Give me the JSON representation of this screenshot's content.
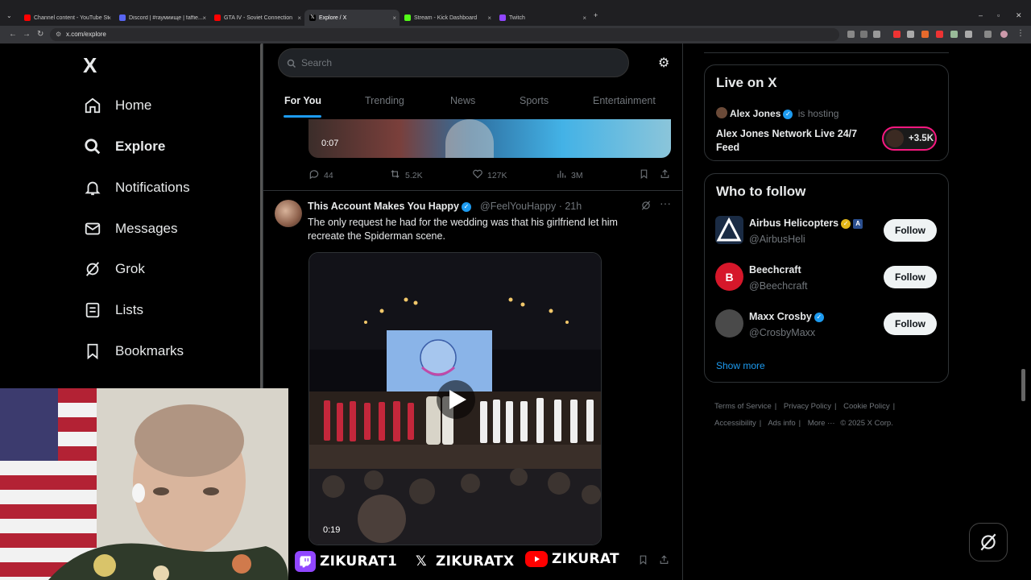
{
  "browser": {
    "tabs": [
      {
        "label": "Channel content - YouTube St",
        "color": "#ff0000"
      },
      {
        "label": "Discord | #гаумиище | faffie...",
        "color": "#5865f2"
      },
      {
        "label": "GTA IV - Soviet Connection",
        "color": "#ff0000"
      },
      {
        "label": "Explore / X",
        "color": "#ffffff"
      },
      {
        "label": "Stream - Kick Dashboard",
        "color": "#53fc18"
      },
      {
        "label": "Twitch",
        "color": "#9146ff"
      }
    ],
    "url": "x.com/explore"
  },
  "sidebar": {
    "logo": "X",
    "items": [
      {
        "label": "Home",
        "icon": "home-icon"
      },
      {
        "label": "Explore",
        "icon": "search-icon"
      },
      {
        "label": "Notifications",
        "icon": "bell-icon"
      },
      {
        "label": "Messages",
        "icon": "envelope-icon"
      },
      {
        "label": "Grok",
        "icon": "grok-icon"
      },
      {
        "label": "Lists",
        "icon": "list-icon"
      },
      {
        "label": "Bookmarks",
        "icon": "bookmark-icon"
      }
    ]
  },
  "center": {
    "search_placeholder": "Search",
    "tabs": [
      "For You",
      "Trending",
      "News",
      "Sports",
      "Entertainment"
    ],
    "prev_post": {
      "video_time": "0:07",
      "replies": "44",
      "reposts": "5.2K",
      "likes": "127K",
      "views": "3M"
    },
    "post": {
      "name": "This Account Makes You Happy",
      "handle": "@FeelYouHappy · 21h",
      "text": "The only request he had for the wedding was that his girlfriend let him recreate the Spiderman scene.",
      "video_time": "0:19"
    }
  },
  "right": {
    "live": {
      "title": "Live on X",
      "host": "Alex Jones",
      "hosting_text": "is hosting",
      "stream_title": "Alex Jones Network Live 24/7 Feed",
      "listeners": "+3.5K"
    },
    "who_to_follow": {
      "title": "Who to follow",
      "users": [
        {
          "name": "Airbus Helicopters",
          "handle": "@AirbusHeli",
          "button": "Follow"
        },
        {
          "name": "Beechcraft",
          "handle": "@Beechcraft",
          "button": "Follow"
        },
        {
          "name": "Maxx Crosby",
          "handle": "@CrosbyMaxx",
          "button": "Follow"
        }
      ],
      "show_more": "Show more"
    },
    "footer": {
      "links": [
        "Terms of Service",
        "Privacy Policy",
        "Cookie Policy",
        "Accessibility",
        "Ads info",
        "More ···"
      ],
      "copyright": "© 2025 X Corp."
    }
  },
  "overlay": {
    "twitch": "ZIKURAT1",
    "x": "ZIKURATX",
    "youtube": "ZIKURAT"
  }
}
